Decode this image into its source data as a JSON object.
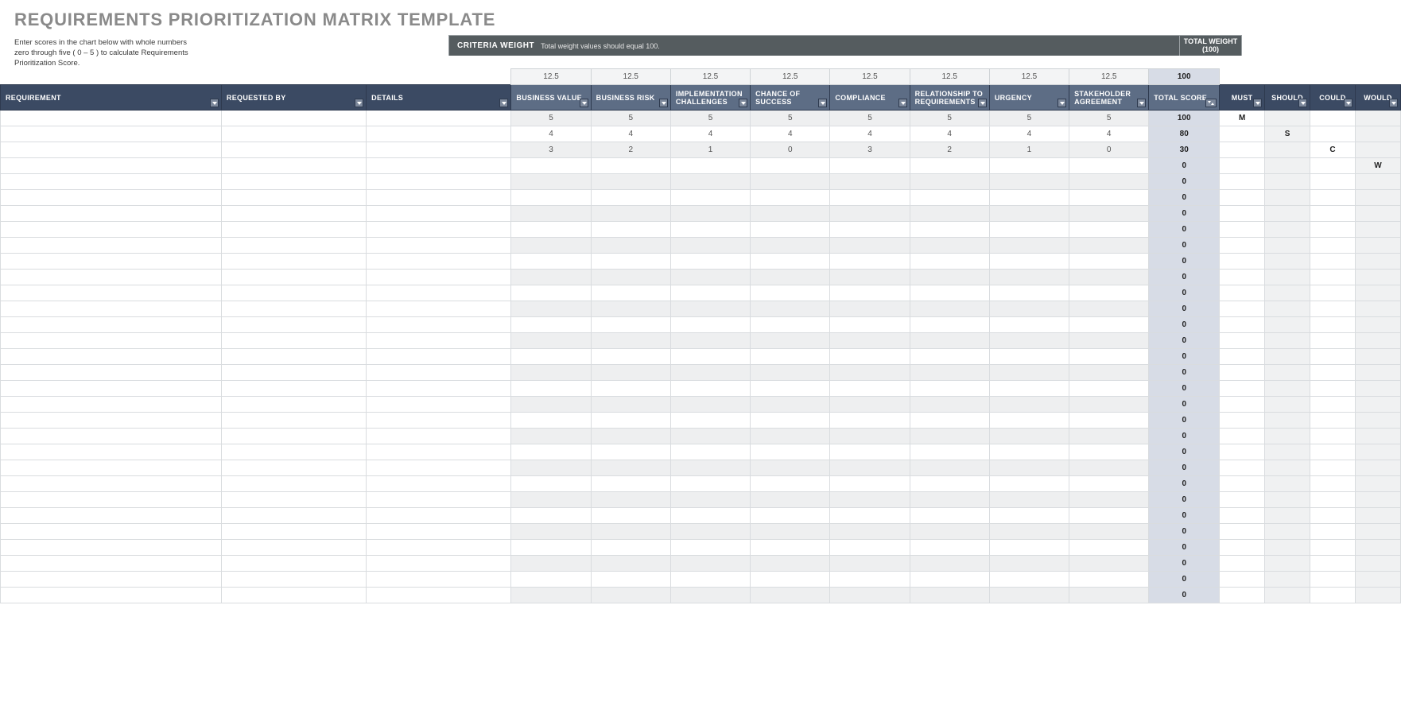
{
  "title": "REQUIREMENTS PRIORITIZATION MATRIX TEMPLATE",
  "instructions_l1": "Enter scores in the chart below with whole numbers",
  "instructions_l2": "zero through five ( 0 – 5 ) to calculate Requirements",
  "instructions_l3": "Prioritization Score.",
  "criteria_weight_label": "CRITERIA WEIGHT",
  "criteria_weight_note": "Total weight values should equal 100.",
  "total_weight_label_l1": "TOTAL WEIGHT",
  "total_weight_label_l2": "(100)",
  "headers": {
    "requirement": "REQUIREMENT",
    "requested_by": "REQUESTED BY",
    "details": "DETAILS",
    "business_value": "BUSINESS VALUE",
    "business_risk": "BUSINESS RISK",
    "implementation_challenges": "IMPLEMENTATION CHALLENGES",
    "chance_of_success": "CHANCE OF SUCCESS",
    "compliance": "COMPLIANCE",
    "relationship_to_requirements": "RELATIONSHIP TO REQUIREMENTS",
    "urgency": "URGENCY",
    "stakeholder_agreement": "STAKEHOLDER AGREEMENT",
    "total_score": "TOTAL SCORE",
    "must": "MUST",
    "should": "SHOULD",
    "could": "COULD",
    "would": "WOULD"
  },
  "weights": [
    "12.5",
    "12.5",
    "12.5",
    "12.5",
    "12.5",
    "12.5",
    "12.5",
    "12.5"
  ],
  "weights_total": "100",
  "rows": [
    {
      "requirement": "",
      "requested_by": "",
      "details": "",
      "scores": [
        "5",
        "5",
        "5",
        "5",
        "5",
        "5",
        "5",
        "5"
      ],
      "total": "100",
      "must": "M",
      "should": "",
      "could": "",
      "would": ""
    },
    {
      "requirement": "",
      "requested_by": "",
      "details": "",
      "scores": [
        "4",
        "4",
        "4",
        "4",
        "4",
        "4",
        "4",
        "4"
      ],
      "total": "80",
      "must": "",
      "should": "S",
      "could": "",
      "would": ""
    },
    {
      "requirement": "",
      "requested_by": "",
      "details": "",
      "scores": [
        "3",
        "2",
        "1",
        "0",
        "3",
        "2",
        "1",
        "0"
      ],
      "total": "30",
      "must": "",
      "should": "",
      "could": "C",
      "would": ""
    },
    {
      "requirement": "",
      "requested_by": "",
      "details": "",
      "scores": [
        "",
        "",
        "",
        "",
        "",
        "",
        "",
        ""
      ],
      "total": "0",
      "must": "",
      "should": "",
      "could": "",
      "would": "W"
    },
    {
      "requirement": "",
      "requested_by": "",
      "details": "",
      "scores": [
        "",
        "",
        "",
        "",
        "",
        "",
        "",
        ""
      ],
      "total": "0",
      "must": "",
      "should": "",
      "could": "",
      "would": ""
    },
    {
      "requirement": "",
      "requested_by": "",
      "details": "",
      "scores": [
        "",
        "",
        "",
        "",
        "",
        "",
        "",
        ""
      ],
      "total": "0",
      "must": "",
      "should": "",
      "could": "",
      "would": ""
    },
    {
      "requirement": "",
      "requested_by": "",
      "details": "",
      "scores": [
        "",
        "",
        "",
        "",
        "",
        "",
        "",
        ""
      ],
      "total": "0",
      "must": "",
      "should": "",
      "could": "",
      "would": ""
    },
    {
      "requirement": "",
      "requested_by": "",
      "details": "",
      "scores": [
        "",
        "",
        "",
        "",
        "",
        "",
        "",
        ""
      ],
      "total": "0",
      "must": "",
      "should": "",
      "could": "",
      "would": ""
    },
    {
      "requirement": "",
      "requested_by": "",
      "details": "",
      "scores": [
        "",
        "",
        "",
        "",
        "",
        "",
        "",
        ""
      ],
      "total": "0",
      "must": "",
      "should": "",
      "could": "",
      "would": ""
    },
    {
      "requirement": "",
      "requested_by": "",
      "details": "",
      "scores": [
        "",
        "",
        "",
        "",
        "",
        "",
        "",
        ""
      ],
      "total": "0",
      "must": "",
      "should": "",
      "could": "",
      "would": ""
    },
    {
      "requirement": "",
      "requested_by": "",
      "details": "",
      "scores": [
        "",
        "",
        "",
        "",
        "",
        "",
        "",
        ""
      ],
      "total": "0",
      "must": "",
      "should": "",
      "could": "",
      "would": ""
    },
    {
      "requirement": "",
      "requested_by": "",
      "details": "",
      "scores": [
        "",
        "",
        "",
        "",
        "",
        "",
        "",
        ""
      ],
      "total": "0",
      "must": "",
      "should": "",
      "could": "",
      "would": ""
    },
    {
      "requirement": "",
      "requested_by": "",
      "details": "",
      "scores": [
        "",
        "",
        "",
        "",
        "",
        "",
        "",
        ""
      ],
      "total": "0",
      "must": "",
      "should": "",
      "could": "",
      "would": ""
    },
    {
      "requirement": "",
      "requested_by": "",
      "details": "",
      "scores": [
        "",
        "",
        "",
        "",
        "",
        "",
        "",
        ""
      ],
      "total": "0",
      "must": "",
      "should": "",
      "could": "",
      "would": ""
    },
    {
      "requirement": "",
      "requested_by": "",
      "details": "",
      "scores": [
        "",
        "",
        "",
        "",
        "",
        "",
        "",
        ""
      ],
      "total": "0",
      "must": "",
      "should": "",
      "could": "",
      "would": ""
    },
    {
      "requirement": "",
      "requested_by": "",
      "details": "",
      "scores": [
        "",
        "",
        "",
        "",
        "",
        "",
        "",
        ""
      ],
      "total": "0",
      "must": "",
      "should": "",
      "could": "",
      "would": ""
    },
    {
      "requirement": "",
      "requested_by": "",
      "details": "",
      "scores": [
        "",
        "",
        "",
        "",
        "",
        "",
        "",
        ""
      ],
      "total": "0",
      "must": "",
      "should": "",
      "could": "",
      "would": ""
    },
    {
      "requirement": "",
      "requested_by": "",
      "details": "",
      "scores": [
        "",
        "",
        "",
        "",
        "",
        "",
        "",
        ""
      ],
      "total": "0",
      "must": "",
      "should": "",
      "could": "",
      "would": ""
    },
    {
      "requirement": "",
      "requested_by": "",
      "details": "",
      "scores": [
        "",
        "",
        "",
        "",
        "",
        "",
        "",
        ""
      ],
      "total": "0",
      "must": "",
      "should": "",
      "could": "",
      "would": ""
    },
    {
      "requirement": "",
      "requested_by": "",
      "details": "",
      "scores": [
        "",
        "",
        "",
        "",
        "",
        "",
        "",
        ""
      ],
      "total": "0",
      "must": "",
      "should": "",
      "could": "",
      "would": ""
    },
    {
      "requirement": "",
      "requested_by": "",
      "details": "",
      "scores": [
        "",
        "",
        "",
        "",
        "",
        "",
        "",
        ""
      ],
      "total": "0",
      "must": "",
      "should": "",
      "could": "",
      "would": ""
    },
    {
      "requirement": "",
      "requested_by": "",
      "details": "",
      "scores": [
        "",
        "",
        "",
        "",
        "",
        "",
        "",
        ""
      ],
      "total": "0",
      "must": "",
      "should": "",
      "could": "",
      "would": ""
    },
    {
      "requirement": "",
      "requested_by": "",
      "details": "",
      "scores": [
        "",
        "",
        "",
        "",
        "",
        "",
        "",
        ""
      ],
      "total": "0",
      "must": "",
      "should": "",
      "could": "",
      "would": ""
    },
    {
      "requirement": "",
      "requested_by": "",
      "details": "",
      "scores": [
        "",
        "",
        "",
        "",
        "",
        "",
        "",
        ""
      ],
      "total": "0",
      "must": "",
      "should": "",
      "could": "",
      "would": ""
    },
    {
      "requirement": "",
      "requested_by": "",
      "details": "",
      "scores": [
        "",
        "",
        "",
        "",
        "",
        "",
        "",
        ""
      ],
      "total": "0",
      "must": "",
      "should": "",
      "could": "",
      "would": ""
    },
    {
      "requirement": "",
      "requested_by": "",
      "details": "",
      "scores": [
        "",
        "",
        "",
        "",
        "",
        "",
        "",
        ""
      ],
      "total": "0",
      "must": "",
      "should": "",
      "could": "",
      "would": ""
    },
    {
      "requirement": "",
      "requested_by": "",
      "details": "",
      "scores": [
        "",
        "",
        "",
        "",
        "",
        "",
        "",
        ""
      ],
      "total": "0",
      "must": "",
      "should": "",
      "could": "",
      "would": ""
    },
    {
      "requirement": "",
      "requested_by": "",
      "details": "",
      "scores": [
        "",
        "",
        "",
        "",
        "",
        "",
        "",
        ""
      ],
      "total": "0",
      "must": "",
      "should": "",
      "could": "",
      "would": ""
    },
    {
      "requirement": "",
      "requested_by": "",
      "details": "",
      "scores": [
        "",
        "",
        "",
        "",
        "",
        "",
        "",
        ""
      ],
      "total": "0",
      "must": "",
      "should": "",
      "could": "",
      "would": ""
    },
    {
      "requirement": "",
      "requested_by": "",
      "details": "",
      "scores": [
        "",
        "",
        "",
        "",
        "",
        "",
        "",
        ""
      ],
      "total": "0",
      "must": "",
      "should": "",
      "could": "",
      "would": ""
    },
    {
      "requirement": "",
      "requested_by": "",
      "details": "",
      "scores": [
        "",
        "",
        "",
        "",
        "",
        "",
        "",
        ""
      ],
      "total": "0",
      "must": "",
      "should": "",
      "could": "",
      "would": ""
    }
  ]
}
